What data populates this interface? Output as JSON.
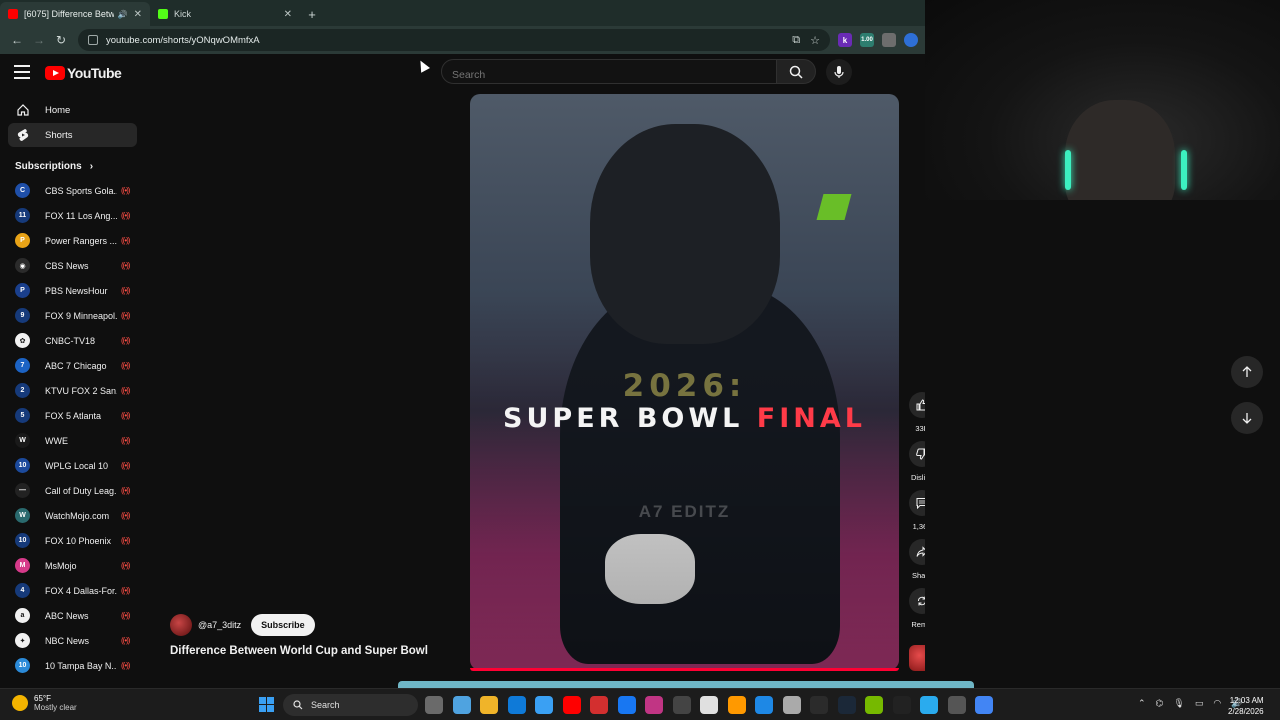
{
  "browser": {
    "tabs": [
      {
        "title": "[6075] Difference Betwee",
        "active": true,
        "favicon_color": "#ff0000"
      },
      {
        "title": "Kick",
        "active": false,
        "favicon_color": "#53fc18"
      }
    ],
    "url": "youtube.com/shorts/yONqwOMmfxA",
    "extensions": [
      {
        "name": "k-icon",
        "label": "k",
        "color": "#6a2bb5"
      },
      {
        "name": "counter-icon",
        "label": "1.00",
        "color": "#2d7d6f"
      },
      {
        "name": "puzzle-icon",
        "label": "",
        "color": "#6d6d6d"
      },
      {
        "name": "profile-icon",
        "label": "",
        "color": "#2e6fd6"
      }
    ]
  },
  "youtube": {
    "logo_text": "YouTube",
    "search_placeholder": "Search",
    "nav": [
      {
        "label": "Home",
        "icon": "home-icon",
        "active": false
      },
      {
        "label": "Shorts",
        "icon": "shorts-icon",
        "active": true
      }
    ],
    "subscriptions_title": "Subscriptions",
    "subscriptions": [
      {
        "name": "CBS Sports Gola...",
        "color": "#1f4fa8",
        "glyph": "C"
      },
      {
        "name": "FOX 11 Los Ang...",
        "color": "#163a7a",
        "glyph": "11"
      },
      {
        "name": "Power Rangers ...",
        "color": "#e8a317",
        "glyph": "P"
      },
      {
        "name": "CBS News",
        "color": "#2b2b2b",
        "glyph": "◉"
      },
      {
        "name": "PBS NewsHour",
        "color": "#1a3f8c",
        "glyph": "P"
      },
      {
        "name": "FOX 9 Minneapol...",
        "color": "#163a7a",
        "glyph": "9"
      },
      {
        "name": "CNBC-TV18",
        "color": "#f2f2f2",
        "glyph": "✿"
      },
      {
        "name": "ABC 7 Chicago",
        "color": "#1c63c4",
        "glyph": "7"
      },
      {
        "name": "KTVU FOX 2 San...",
        "color": "#163a7a",
        "glyph": "2"
      },
      {
        "name": "FOX 5 Atlanta",
        "color": "#163a7a",
        "glyph": "5"
      },
      {
        "name": "WWE",
        "color": "#1a1a1a",
        "glyph": "W"
      },
      {
        "name": "WPLG Local 10",
        "color": "#1c4a9c",
        "glyph": "10"
      },
      {
        "name": "Call of Duty Leag...",
        "color": "#222222",
        "glyph": "—"
      },
      {
        "name": "WatchMojo.com",
        "color": "#2a6a6e",
        "glyph": "W"
      },
      {
        "name": "FOX 10 Phoenix",
        "color": "#163a7a",
        "glyph": "10"
      },
      {
        "name": "MsMojo",
        "color": "#d63a8a",
        "glyph": "M"
      },
      {
        "name": "FOX 4 Dallas-For...",
        "color": "#163a7a",
        "glyph": "4"
      },
      {
        "name": "ABC News",
        "color": "#f1f1f1",
        "glyph": "a"
      },
      {
        "name": "NBC News",
        "color": "#f1f1f1",
        "glyph": "✦"
      },
      {
        "name": "10 Tampa Bay N...",
        "color": "#2b8ad8",
        "glyph": "10"
      }
    ],
    "short": {
      "overlay_year": "2026:",
      "overlay_title_white": "SUPER BOWL ",
      "overlay_title_red": "FINAL",
      "watermark": "A7 EDITZ",
      "channel_handle": "@a7_3ditz",
      "subscribe_label": "Subscribe",
      "title": "Difference Between World Cup and Super Bowl",
      "actions": {
        "likes": "33K",
        "dislike": "Dislike",
        "comments": "1,368",
        "share": "Share",
        "remix": "Remix"
      }
    }
  },
  "taskbar": {
    "weather_temp": "65°F",
    "weather_desc": "Mostly clear",
    "search_label": "Search",
    "apps": [
      "#6a6a6a",
      "#4fa3e0",
      "#f0b429",
      "#0f7ad8",
      "#3aa0f3",
      "#ff0000",
      "#d32f2f",
      "#1877f2",
      "#c13584",
      "#444444",
      "#e0e0e0",
      "#f90",
      "#1e88e5",
      "#aaaaaa",
      "#2b2b2b",
      "#1b2838",
      "#76b900",
      "#222222",
      "#2aabee",
      "#555555",
      "#4285f4"
    ],
    "time": "12:03 AM",
    "date": "2/28/2026"
  }
}
